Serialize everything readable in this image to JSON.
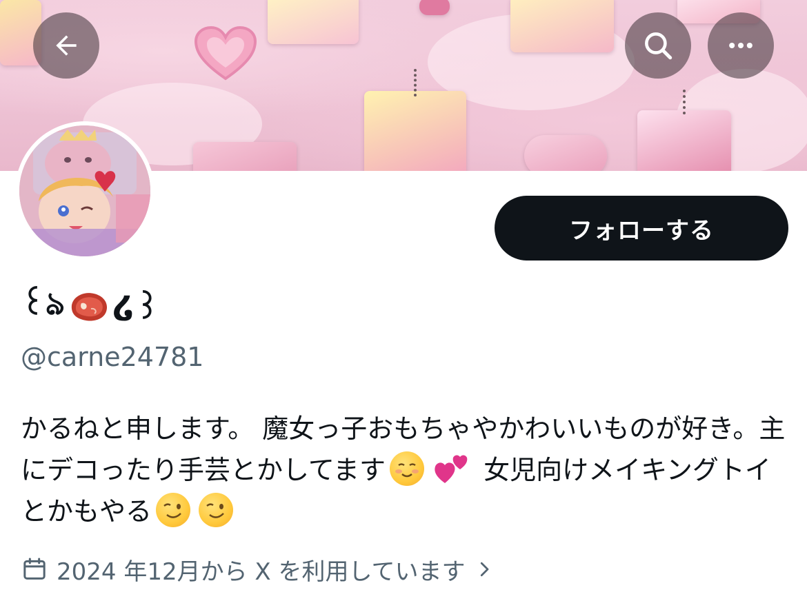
{
  "header": {
    "back_icon": "arrow-left-icon",
    "search_icon": "search-icon",
    "more_icon": "more-horizontal-icon"
  },
  "profile": {
    "display_name_left": "꒰ঌ",
    "display_name_right": "໒꒱",
    "display_name_emoji": "cut-of-meat-emoji",
    "handle": "@carne24781",
    "follow_label": "フォローする",
    "bio": {
      "part1": "かるねと申します。 魔女っ子おもちゃやかわいいものが好き。主にデコったり手芸とかしてます",
      "part2": "女児向けメイキングトイとかもやる"
    },
    "joined_text": "2024 年12月から X を利用しています",
    "calendar_icon": "calendar-icon",
    "chevron_icon": "chevron-right-icon"
  },
  "colors": {
    "follow_bg": "#0f1419",
    "secondary_text": "#536471",
    "banner_pink": "#f2cddd"
  }
}
